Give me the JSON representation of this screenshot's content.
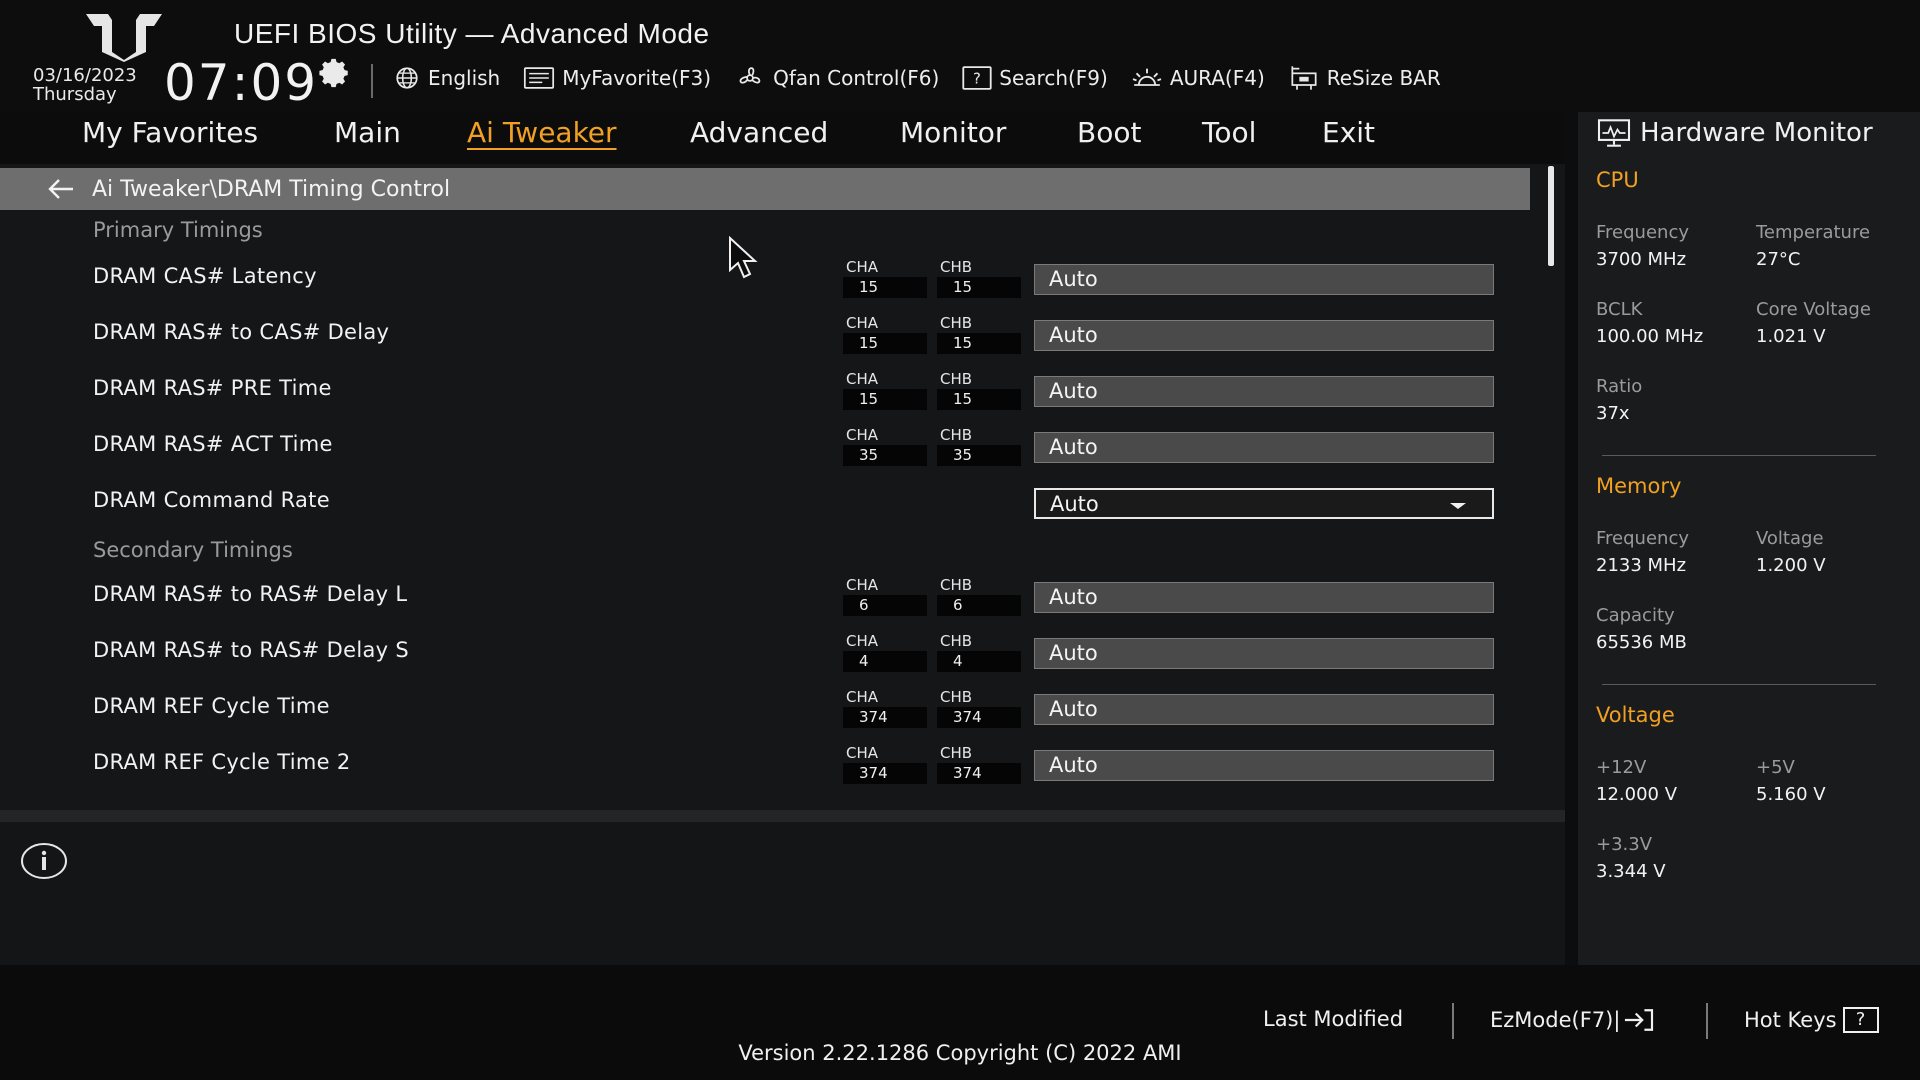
{
  "header": {
    "title": "UEFI BIOS Utility — Advanced Mode",
    "date": "03/16/2023",
    "day": "Thursday",
    "time": "07:09"
  },
  "toolbar": [
    {
      "label": "English",
      "icon": "globe-icon"
    },
    {
      "label": "MyFavorite(F3)",
      "icon": "favorite-icon"
    },
    {
      "label": "Qfan Control(F6)",
      "icon": "fan-icon"
    },
    {
      "label": "Search(F9)",
      "icon": "search-icon"
    },
    {
      "label": "AURA(F4)",
      "icon": "aura-icon"
    },
    {
      "label": "ReSize BAR",
      "icon": "resize-bar-icon"
    }
  ],
  "tabs": [
    {
      "label": "My Favorites"
    },
    {
      "label": "Main"
    },
    {
      "label": "Ai Tweaker",
      "active": true
    },
    {
      "label": "Advanced"
    },
    {
      "label": "Monitor"
    },
    {
      "label": "Boot"
    },
    {
      "label": "Tool"
    },
    {
      "label": "Exit"
    }
  ],
  "breadcrumb": "Ai Tweaker\\DRAM Timing Control",
  "sections": {
    "primary": "Primary Timings",
    "secondary": "Secondary Timings"
  },
  "channel_labels": {
    "a": "CHA",
    "b": "CHB"
  },
  "rows": [
    {
      "label": "DRAM CAS# Latency",
      "cha": "15",
      "chb": "15",
      "value": "Auto"
    },
    {
      "label": "DRAM RAS# to CAS# Delay",
      "cha": "15",
      "chb": "15",
      "value": "Auto"
    },
    {
      "label": "DRAM RAS# PRE Time",
      "cha": "15",
      "chb": "15",
      "value": "Auto"
    },
    {
      "label": "DRAM RAS# ACT Time",
      "cha": "35",
      "chb": "35",
      "value": "Auto"
    },
    {
      "label": "DRAM Command Rate",
      "value": "Auto",
      "type": "select"
    },
    {
      "label": "DRAM RAS# to RAS# Delay L",
      "cha": "6",
      "chb": "6",
      "value": "Auto"
    },
    {
      "label": "DRAM RAS# to RAS# Delay S",
      "cha": "4",
      "chb": "4",
      "value": "Auto"
    },
    {
      "label": "DRAM REF Cycle Time",
      "cha": "374",
      "chb": "374",
      "value": "Auto"
    },
    {
      "label": "DRAM REF Cycle Time 2",
      "cha": "374",
      "chb": "374",
      "value": "Auto"
    }
  ],
  "hardware_monitor": {
    "title": "Hardware Monitor",
    "cpu": {
      "heading": "CPU",
      "frequency_label": "Frequency",
      "frequency": "3700 MHz",
      "temperature_label": "Temperature",
      "temperature": "27°C",
      "bclk_label": "BCLK",
      "bclk": "100.00 MHz",
      "core_voltage_label": "Core Voltage",
      "core_voltage": "1.021 V",
      "ratio_label": "Ratio",
      "ratio": "37x"
    },
    "memory": {
      "heading": "Memory",
      "frequency_label": "Frequency",
      "frequency": "2133 MHz",
      "voltage_label": "Voltage",
      "voltage": "1.200 V",
      "capacity_label": "Capacity",
      "capacity": "65536 MB"
    },
    "voltage": {
      "heading": "Voltage",
      "v12_label": "+12V",
      "v12": "12.000 V",
      "v5_label": "+5V",
      "v5": "5.160 V",
      "v33_label": "+3.3V",
      "v33": "3.344 V"
    }
  },
  "footer": {
    "last_modified": "Last Modified",
    "ezmode": "EzMode(F7)|",
    "hotkeys": "Hot Keys",
    "hotkeys_glyph": "?",
    "version": "Version 2.22.1286 Copyright (C) 2022 AMI"
  },
  "colors": {
    "accent": "#f0a022",
    "crumb_bg": "#6e6e6e",
    "field_bg": "#4a4a4a"
  }
}
